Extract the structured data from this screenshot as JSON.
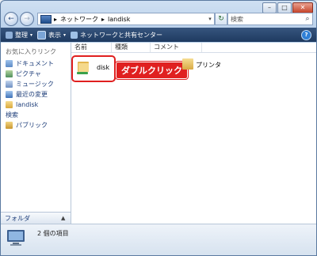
{
  "window": {
    "controls": {
      "minimize": "–",
      "maximize": "□",
      "close": "✕"
    }
  },
  "nav": {
    "back_icon": "←",
    "forward_icon": "→"
  },
  "address": {
    "separator": "▸",
    "segments": [
      "ネットワーク",
      "landisk"
    ],
    "dropdown_icon": "▾"
  },
  "refresh_icon": "↻",
  "search": {
    "placeholder": "検索",
    "icon": "⌕"
  },
  "toolbar": {
    "organize": "整理",
    "view": "表示",
    "network_center": "ネットワークと共有センター",
    "arrow": "▾",
    "help": "?"
  },
  "sidebar": {
    "favorites_header": "お気に入りリンク",
    "items": [
      {
        "label": "ドキュメント",
        "icon": "doc"
      },
      {
        "label": "ピクチャ",
        "icon": "pic"
      },
      {
        "label": "ミュージック",
        "icon": "mus"
      },
      {
        "label": "最近の変更",
        "icon": "rec"
      },
      {
        "label": "landisk",
        "icon": "folder"
      },
      {
        "label": "検索",
        "icon": "search"
      },
      {
        "label": "パブリック",
        "icon": "pub"
      }
    ],
    "folder_bar": "フォルダ",
    "folder_bar_icon": "▲"
  },
  "columns": {
    "name": "名前",
    "type": "種類",
    "comment": "コメント"
  },
  "items": {
    "disk": "disk",
    "printer": "プリンタ"
  },
  "annotation": {
    "callout": "ダブルクリック",
    "color": "#e02020"
  },
  "status": {
    "count": "2 個の項目"
  }
}
